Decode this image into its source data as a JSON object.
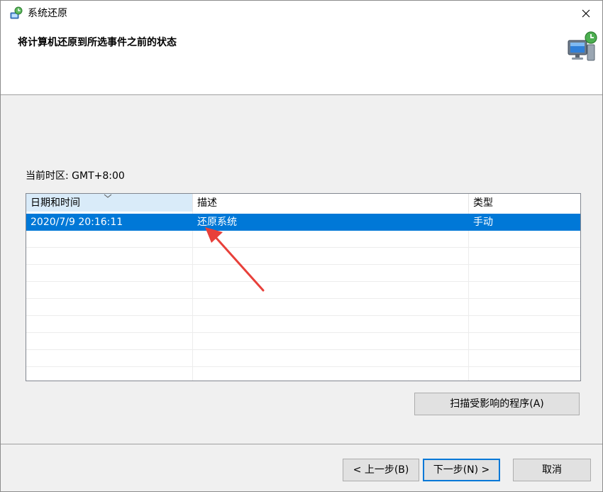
{
  "window": {
    "title": "系统还原",
    "heading": "将计算机还原到所选事件之前的状态"
  },
  "timezone_label": "当前时区: GMT+8:00",
  "list": {
    "columns": [
      "日期和时间",
      "描述",
      "类型"
    ],
    "rows": [
      {
        "date": "2020/7/9 20:16:11",
        "description": "还原系统",
        "type": "手动",
        "selected": true
      }
    ]
  },
  "buttons": {
    "scan": "扫描受影响的程序(A)",
    "back": "< 上一步(B)",
    "next": "下一步(N) >",
    "cancel": "取消"
  },
  "colors": {
    "selection": "#0078d7",
    "annotation_arrow": "#e8403a"
  },
  "icons": {
    "title": "system-restore-icon",
    "header": "system-restore-computer-icon",
    "close": "close-icon",
    "sort": "chevron-down-icon"
  }
}
